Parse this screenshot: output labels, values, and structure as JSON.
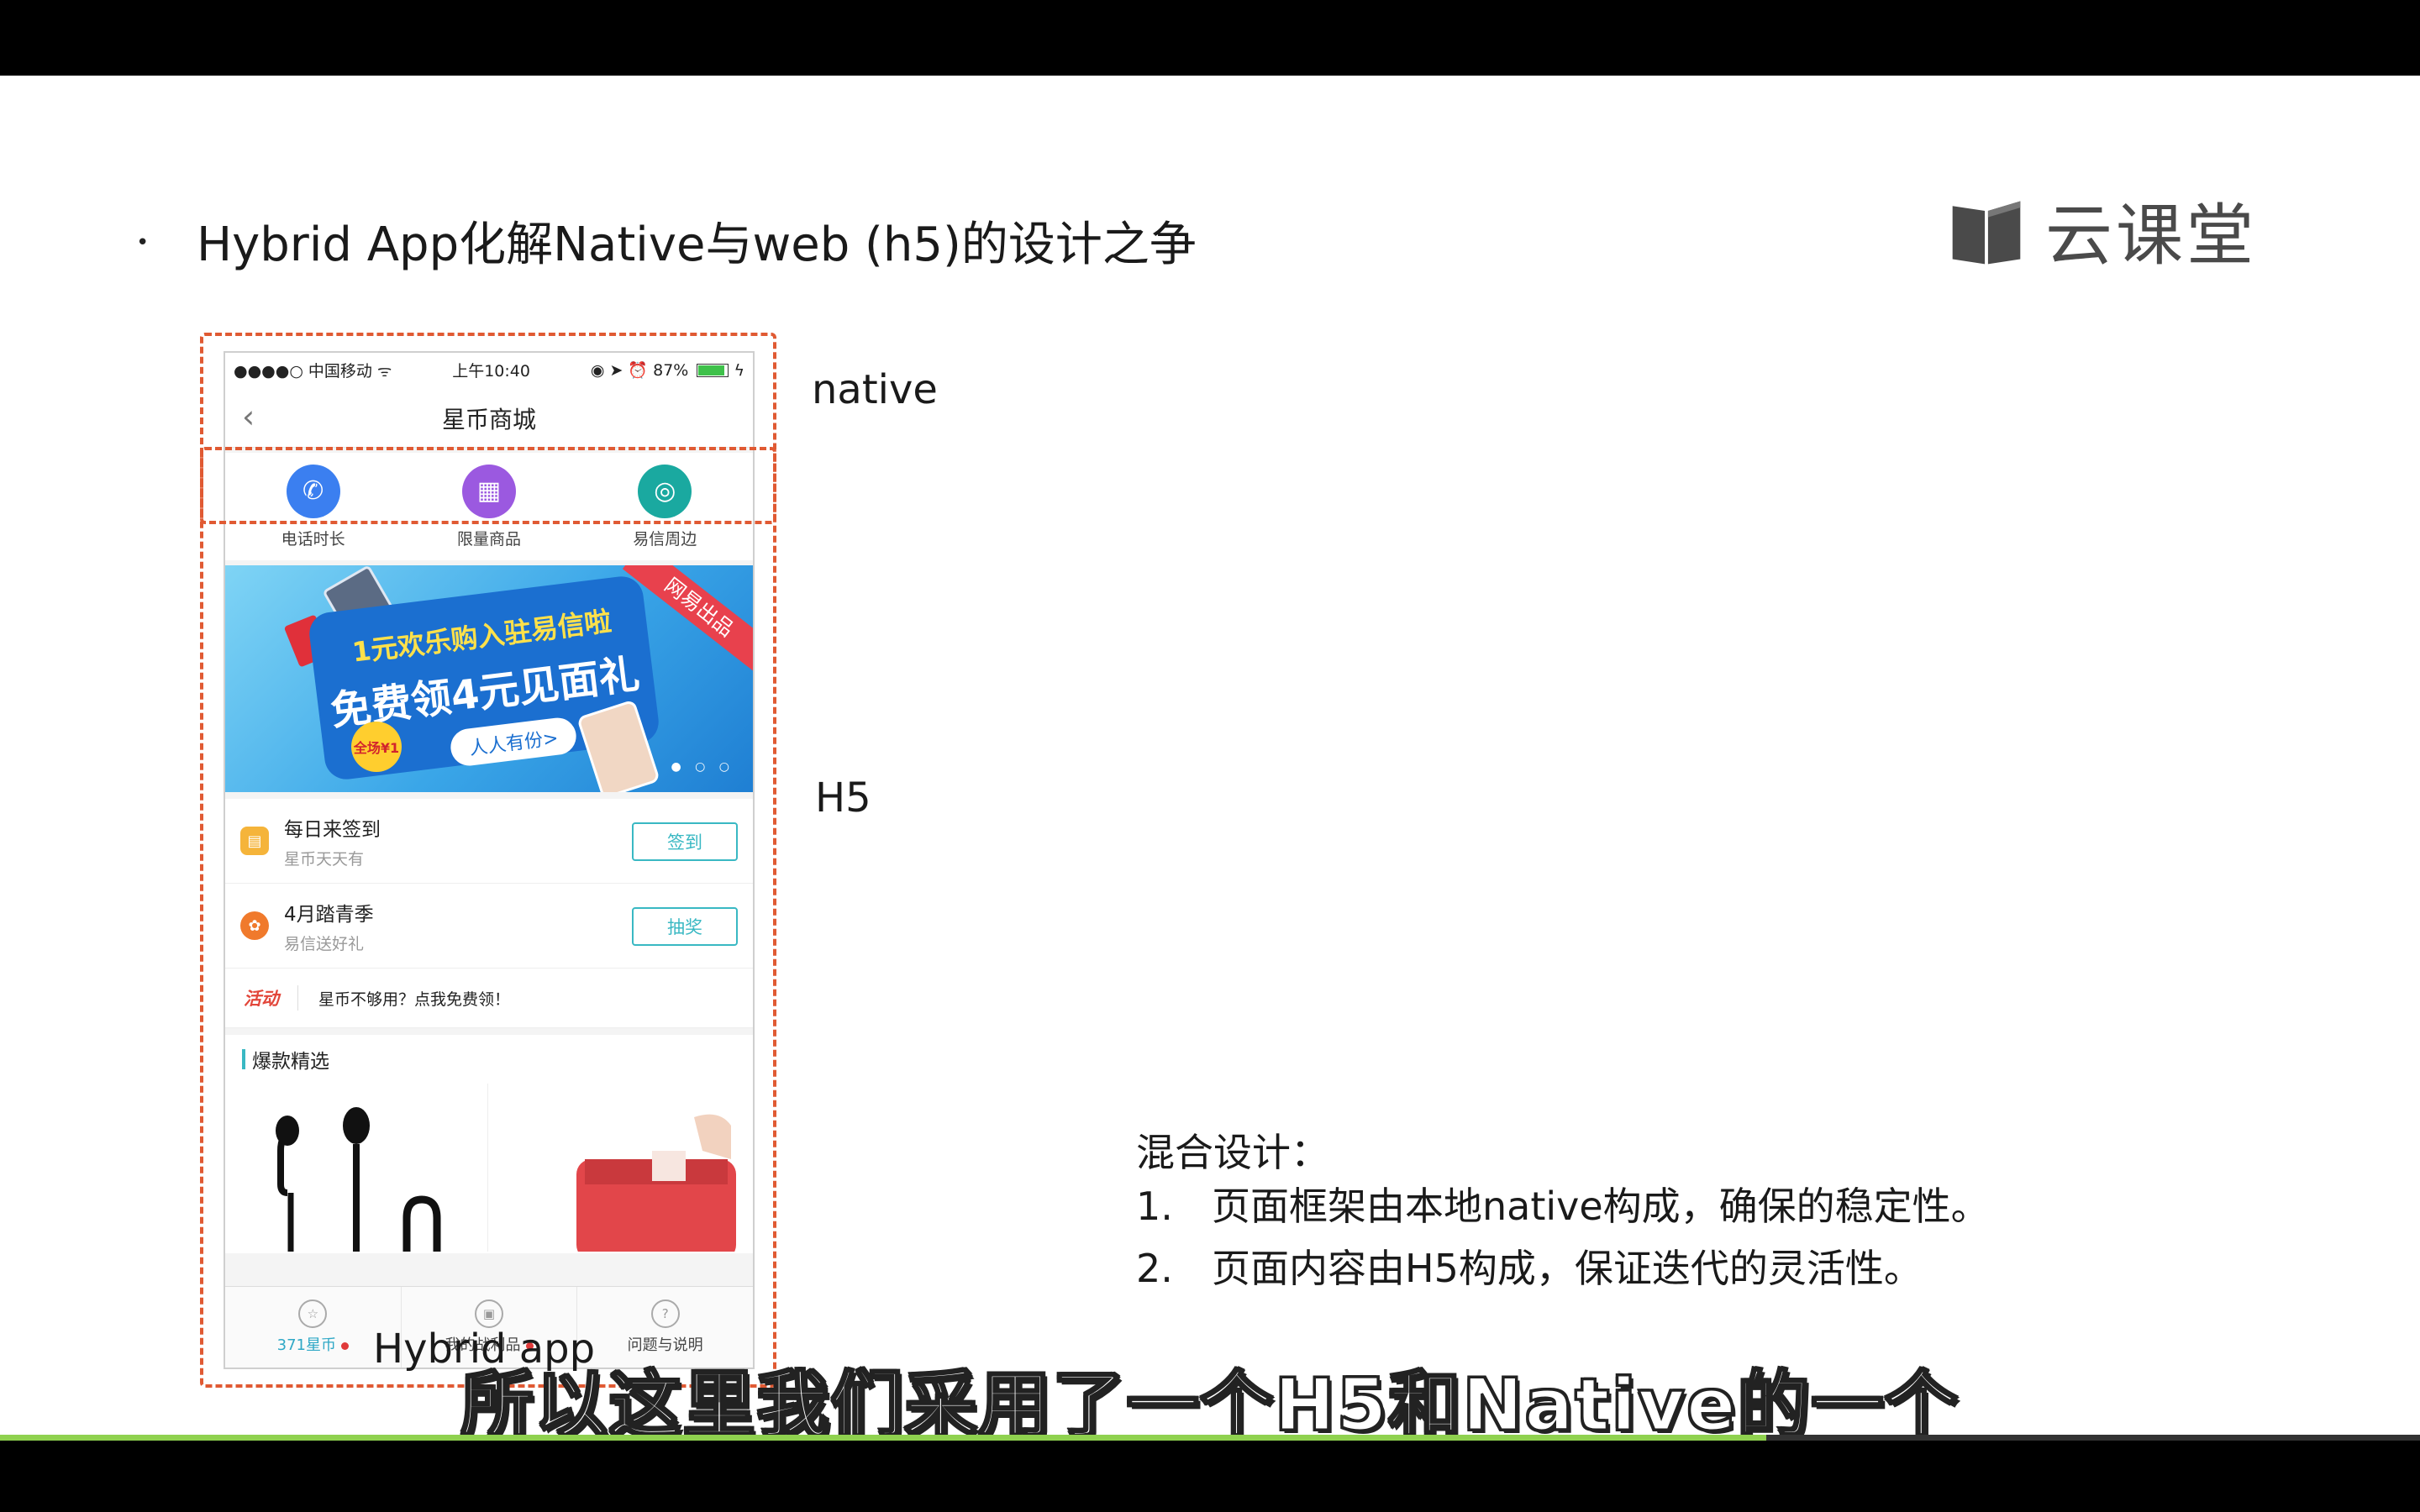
{
  "slide": {
    "bullet": "•",
    "title": "Hybrid App化解Native与web (h5)的设计之争",
    "logo_text": "云课堂",
    "label_native": "native",
    "label_h5": "H5",
    "label_hybrid": "Hybrid app"
  },
  "phone": {
    "status": {
      "carrier": "●●●●○ 中国移动 ᯤ",
      "time": "上午10:40",
      "right": "◉ ➤ ⏰ 87%"
    },
    "nav": {
      "back": "‹",
      "title": "星币商城"
    },
    "icons": [
      {
        "label": "电话时长",
        "color": "#3b7ff0",
        "glyph": "✆",
        "icon": "phone-icon"
      },
      {
        "label": "限量商品",
        "color": "#9b59e0",
        "glyph": "▦",
        "icon": "gift-icon"
      },
      {
        "label": "易信周边",
        "color": "#1aa9a0",
        "glyph": "◎",
        "icon": "yixin-icon"
      }
    ],
    "banner": {
      "line1": "1元欢乐购入驻易信啦",
      "line2": "免费领4元见面礼",
      "pill": "人人有份>",
      "ribbon": "网易出品",
      "badge": "全场¥1"
    },
    "tasks": [
      {
        "title": "每日来签到",
        "sub": "星币天天有",
        "button": "签到",
        "icon_color": "#f5b43a"
      },
      {
        "title": "4月踏青季",
        "sub": "易信送好礼",
        "button": "抽奖",
        "icon_color": "#f07a2c"
      }
    ],
    "activity": {
      "tag": "活动",
      "text": "星币不够用？点我免费领！"
    },
    "featured": {
      "title": "爆款精选"
    },
    "tabs": [
      {
        "label": "371星币",
        "icon": "star-icon",
        "glyph": "☆",
        "dot": true
      },
      {
        "label": "我的战利品",
        "icon": "box-icon",
        "glyph": "▣",
        "dot": true
      },
      {
        "label": "问题与说明",
        "icon": "question-icon",
        "glyph": "?",
        "dot": false
      }
    ]
  },
  "mixed": {
    "title": "混合设计：",
    "items": [
      {
        "num": "1.",
        "text": "页面框架由本地native构成，确保的稳定性。"
      },
      {
        "num": "2.",
        "text": "页面内容由H5构成，保证迭代的灵活性。"
      }
    ]
  },
  "subtitle": "所以这里我们采用了一个H5和Native的一个",
  "video": {
    "progress": 0.73
  },
  "colors": {
    "dashed": "#e05a33",
    "accent": "#39b8c3",
    "progress": "#8fd14f"
  }
}
